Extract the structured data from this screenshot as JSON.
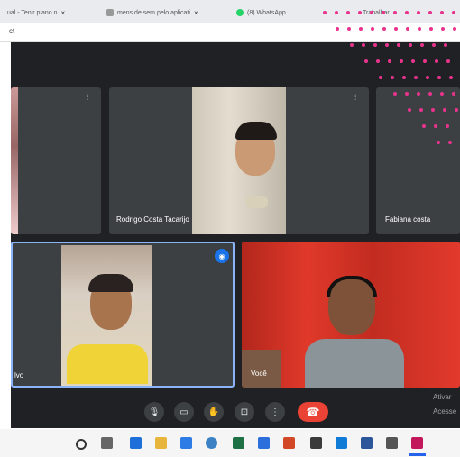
{
  "browser": {
    "tabs": [
      {
        "label": "ual - Tenir plano n",
        "close": "×"
      },
      {
        "label": "mens de sem pelo aplicati",
        "close": "×"
      },
      {
        "label": "(8) WhatsApp",
        "close": "×"
      },
      {
        "label": "Trabalhar"
      }
    ],
    "address": "ct"
  },
  "meet": {
    "participants": [
      {
        "name": "Rodrigo Costa Tacarijo"
      },
      {
        "name": "Fabiana costa"
      },
      {
        "name": "lvo"
      },
      {
        "name": "Você"
      }
    ],
    "captions_label": "Ativar",
    "caption_sub": "Acesse",
    "controls": [
      "mic-icon",
      "camera-icon",
      "raise-hand-icon",
      "present-icon",
      "more-icon",
      "hangup-icon"
    ]
  },
  "taskbar": {
    "icons": [
      "search-icon",
      "taskview-icon",
      "edge-icon",
      "folder-icon",
      "store-icon",
      "chrome-icon",
      "excel-icon",
      "ie-icon",
      "powerpoint-icon",
      "app-icon",
      "edge-icon",
      "word-icon",
      "teams-icon",
      "app-icon"
    ]
  },
  "colors": {
    "accent": "#e8338d",
    "hangup": "#ea4335",
    "meet_bg": "#202124",
    "tile_bg": "#3c4043",
    "highlight": "#8ab4f8"
  }
}
